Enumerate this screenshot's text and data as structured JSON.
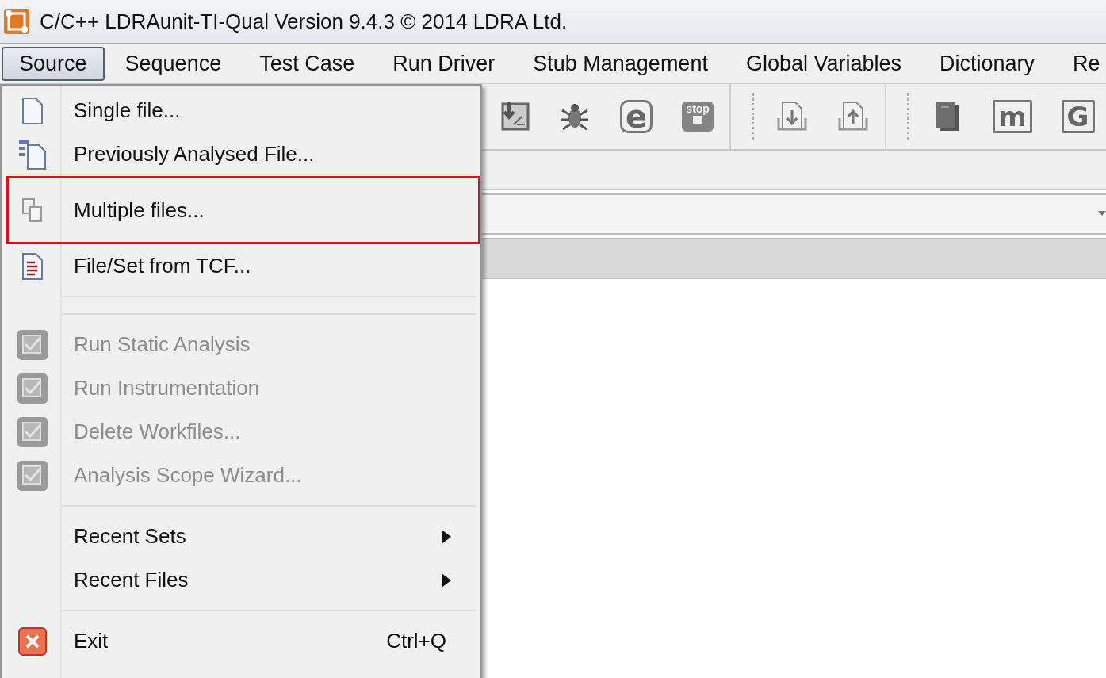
{
  "window": {
    "title": "C/C++ LDRAunit-TI-Qual Version 9.4.3 © 2014 LDRA Ltd."
  },
  "menubar": [
    {
      "label": "Source",
      "selected": true
    },
    {
      "label": "Sequence",
      "selected": false
    },
    {
      "label": "Test Case",
      "selected": false
    },
    {
      "label": "Run Driver",
      "selected": false
    },
    {
      "label": "Stub Management",
      "selected": false
    },
    {
      "label": "Global Variables",
      "selected": false
    },
    {
      "label": "Dictionary",
      "selected": false
    },
    {
      "label": "Re",
      "selected": false
    }
  ],
  "toolbar": [
    [
      {
        "kind": "import"
      },
      {
        "kind": "bug"
      },
      {
        "kind": "letter",
        "text": "e"
      },
      {
        "kind": "stop",
        "text": "stop"
      }
    ],
    [
      {
        "kind": "download"
      },
      {
        "kind": "upload"
      }
    ],
    [
      {
        "kind": "book"
      },
      {
        "kind": "letter",
        "text": "m"
      },
      {
        "kind": "letter",
        "text": "G"
      }
    ]
  ],
  "source_menu": [
    {
      "kind": "file",
      "label": "Single file...",
      "disabled": false,
      "highlighted": false
    },
    {
      "kind": "history",
      "label": "Previously Analysed File...",
      "disabled": false,
      "highlighted": false
    },
    {
      "kind": "multi",
      "label": "Multiple files...",
      "disabled": false,
      "highlighted": true
    },
    {
      "kind": "tcf",
      "label": "File/Set from TCF...",
      "disabled": false,
      "highlighted": false
    },
    {
      "kind": "separator"
    },
    {
      "kind": "separator"
    },
    {
      "kind": "action",
      "label": "Run Static Analysis",
      "disabled": true,
      "highlighted": false
    },
    {
      "kind": "action",
      "label": "Run Instrumentation",
      "disabled": true,
      "highlighted": false
    },
    {
      "kind": "action",
      "label": "Delete Workfiles...",
      "disabled": true,
      "highlighted": false
    },
    {
      "kind": "action",
      "label": "Analysis Scope Wizard...",
      "disabled": true,
      "highlighted": false
    },
    {
      "kind": "separator"
    },
    {
      "kind": "submenu",
      "label": "Recent Sets"
    },
    {
      "kind": "submenu",
      "label": "Recent Files"
    },
    {
      "kind": "separator"
    },
    {
      "kind": "exit",
      "label": "Exit",
      "shortcut": "Ctrl+Q",
      "disabled": false,
      "highlighted": false
    }
  ]
}
